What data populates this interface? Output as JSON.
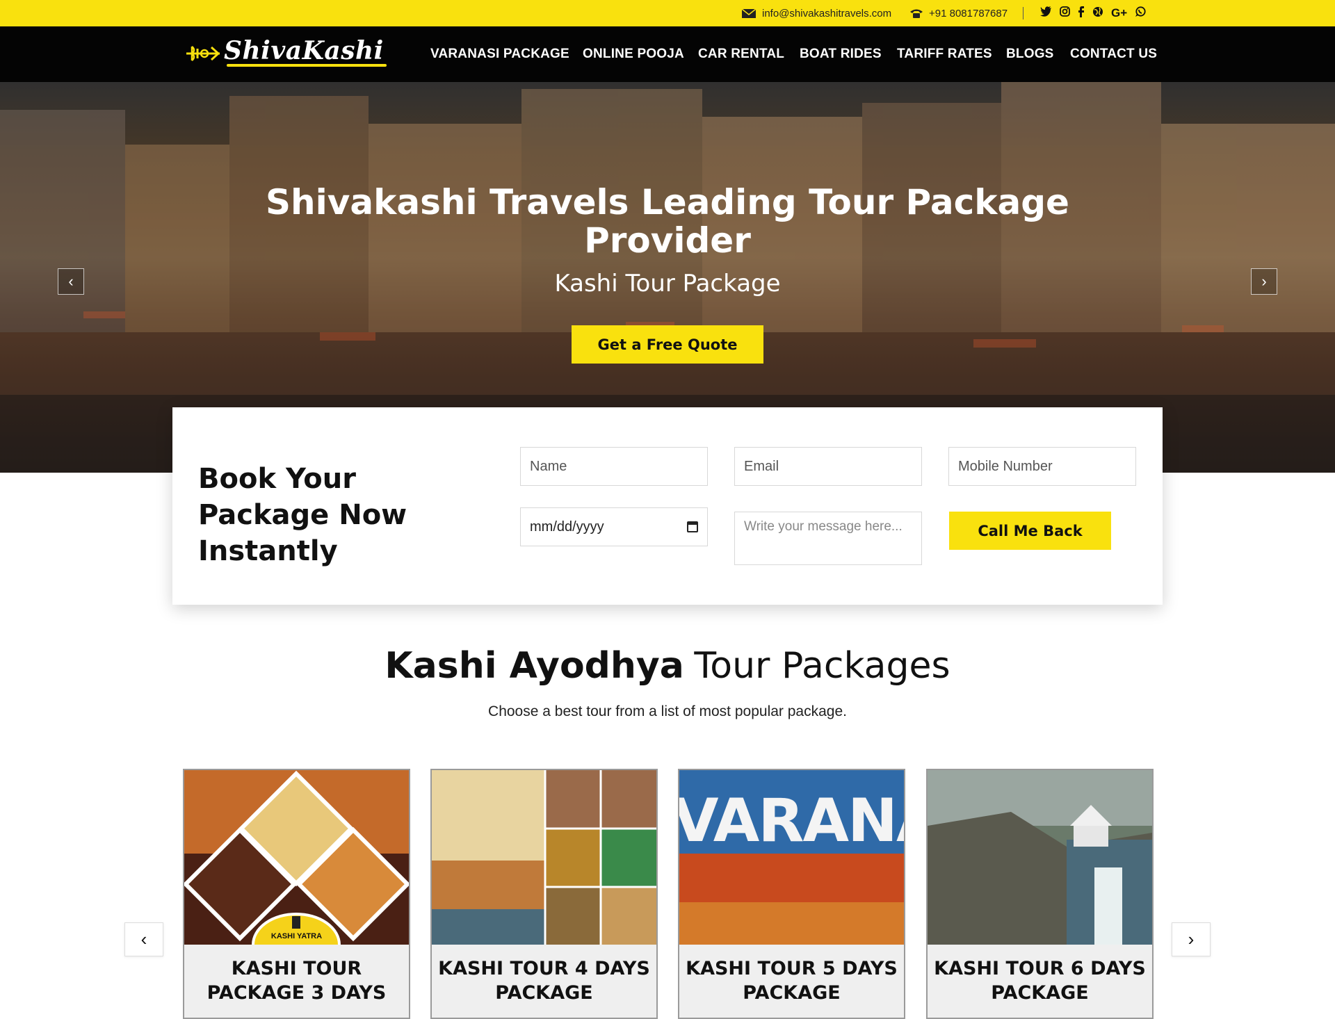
{
  "topbar": {
    "email": "info@shivakashitravels.com",
    "phone": "+91 8081787687",
    "social_icons": [
      "twitter-icon",
      "instagram-icon",
      "facebook-icon",
      "globe-icon",
      "google-plus-icon",
      "whatsapp-icon"
    ]
  },
  "brand": {
    "logo_text": "ShivaKashi"
  },
  "nav": {
    "items": [
      {
        "label": "VARANASI PACKAGE"
      },
      {
        "label": "ONLINE POOJA"
      },
      {
        "label": "CAR RENTAL"
      },
      {
        "label": "BOAT RIDES"
      },
      {
        "label": "TARIFF RATES"
      },
      {
        "label": "BLOGS"
      },
      {
        "label": "CONTACT US"
      }
    ]
  },
  "hero": {
    "title": "Shivakashi Travels Leading Tour Package Provider",
    "subtitle": "Kashi Tour Package",
    "cta": "Get a Free Quote",
    "prev_glyph": "‹",
    "next_glyph": "›"
  },
  "booking": {
    "title": "Book Your Package Now Instantly",
    "name_placeholder": "Name",
    "email_placeholder": "Email",
    "mobile_placeholder": "Mobile Number",
    "date_placeholder": "mm/dd/yyyy",
    "message_placeholder": "Write your message here...",
    "submit": "Call Me Back"
  },
  "packages": {
    "title_bold": "Kashi Ayodhya",
    "title_light": "Tour Packages",
    "subtitle": "Choose a best tour from a list of most popular package.",
    "prev_glyph": "‹",
    "next_glyph": "›",
    "cards": [
      {
        "title": "KASHI TOUR PACKAGE 3 DAYS",
        "badge": "KASHI YATRA"
      },
      {
        "title": "KASHI TOUR 4 DAYS PACKAGE"
      },
      {
        "title": "KASHI TOUR 5 DAYS PACKAGE",
        "image_text": "VARANAS"
      },
      {
        "title": "KASHI TOUR 6 DAYS PACKAGE"
      }
    ]
  },
  "colors": {
    "accent": "#f9e10e",
    "nav_bg": "#040404",
    "text": "#111111"
  }
}
